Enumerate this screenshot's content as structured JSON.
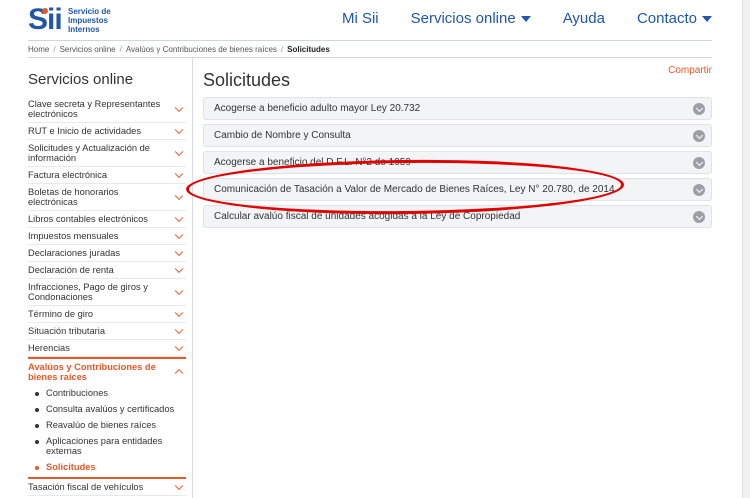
{
  "logo": {
    "mark": "Sii",
    "lines": [
      "Servicio de",
      "Impuestos",
      "Internos"
    ]
  },
  "nav": {
    "items": [
      {
        "label": "Mi Sii",
        "dropdown": false
      },
      {
        "label": "Servicios online",
        "dropdown": true
      },
      {
        "label": "Ayuda",
        "dropdown": false
      },
      {
        "label": "Contacto",
        "dropdown": true
      }
    ]
  },
  "breadcrumb": {
    "items": [
      "Home",
      "Servicios online",
      "Avalúos y Contribuciones de bienes raíces"
    ],
    "current": "Solicitudes"
  },
  "sidebar": {
    "title": "Servicios online",
    "items": [
      "Clave secreta y Representantes electrónicos",
      "RUT e Inicio de actividades",
      "Solicitudes y Actualización de información",
      "Factura electrónica",
      "Boletas de honorarios electrónicas",
      "Libros contables electrónicos",
      "Impuestos mensuales",
      "Declaraciones juradas",
      "Declaración de renta",
      "Infracciones, Pago de giros y Condonaciones",
      "Término de giro",
      "Situación tributaria",
      "Herencias"
    ],
    "active_item": "Avalúos y Contribuciones de bienes raíces",
    "sub_items": [
      "Contribuciones",
      "Consulta avalúos y certificados",
      "Reavalúo de bienes raíces",
      "Aplicaciones para entidades externas"
    ],
    "current_sub": "Solicitudes",
    "after_items": [
      "Tasación fiscal de vehículos"
    ]
  },
  "main": {
    "title": "Solicitudes",
    "share_label": "Compartir",
    "accordion": [
      "Acogerse a beneficio adulto mayor Ley 20.732",
      "Cambio de Nombre y Consulta",
      "Acogerse a beneficio del D.F.L. N°2 de 1959",
      "Comunicación de Tasación a Valor de Mercado de Bienes Raíces, Ley N° 20.780, de 2014",
      "Calcular avalúo fiscal de unidades acogidas a la Ley de Copropiedad"
    ]
  },
  "colors": {
    "brand_blue": "#1f57a6",
    "accent_orange": "#e05a2a",
    "highlight_red": "#e00000"
  }
}
